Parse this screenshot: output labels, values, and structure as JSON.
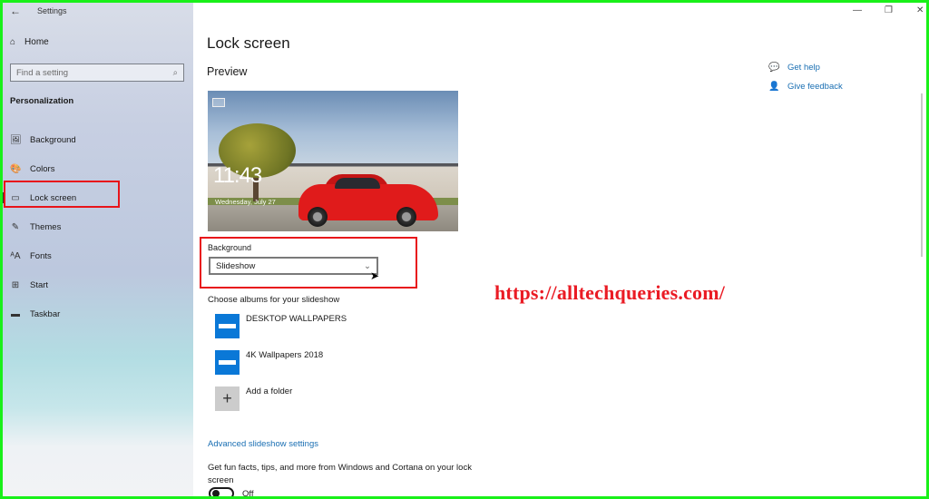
{
  "window": {
    "title": "Settings",
    "controls": {
      "minimize": "—",
      "maximize": "❐",
      "close": "✕"
    }
  },
  "sidebar": {
    "back_icon": "←",
    "home_label": "Home",
    "search_placeholder": "Find a setting",
    "section_title": "Personalization",
    "items": [
      {
        "label": "Background",
        "icon": "🖼"
      },
      {
        "label": "Colors",
        "icon": "🎨"
      },
      {
        "label": "Lock screen",
        "icon": "▭"
      },
      {
        "label": "Themes",
        "icon": "✎"
      },
      {
        "label": "Fonts",
        "icon": "ᴬA"
      },
      {
        "label": "Start",
        "icon": "⊞"
      },
      {
        "label": "Taskbar",
        "icon": "▬"
      }
    ],
    "selected": "Lock screen"
  },
  "main": {
    "title": "Lock screen",
    "preview_label": "Preview",
    "preview": {
      "time": "11:43",
      "date": "Wednesday, July 27"
    },
    "background_label": "Background",
    "background_value": "Slideshow",
    "albums_label": "Choose albums for your slideshow",
    "albums": [
      {
        "name": "DESKTOP WALLPAPERS"
      },
      {
        "name": "4K Wallpapers 2018"
      }
    ],
    "add_folder_label": "Add a folder",
    "advanced_link": "Advanced slideshow settings",
    "tips_text": "Get fun facts, tips, and more from Windows and Cortana on your lock screen",
    "tips_toggle_state": "Off"
  },
  "help_links": {
    "get_help": "Get help",
    "give_feedback": "Give feedback"
  },
  "watermark": "https://alltechqueries.com/",
  "colors": {
    "accent": "#0a78d7",
    "link": "#1a6fb3",
    "highlight_box": "#e8141a",
    "frame": "#19f019"
  }
}
